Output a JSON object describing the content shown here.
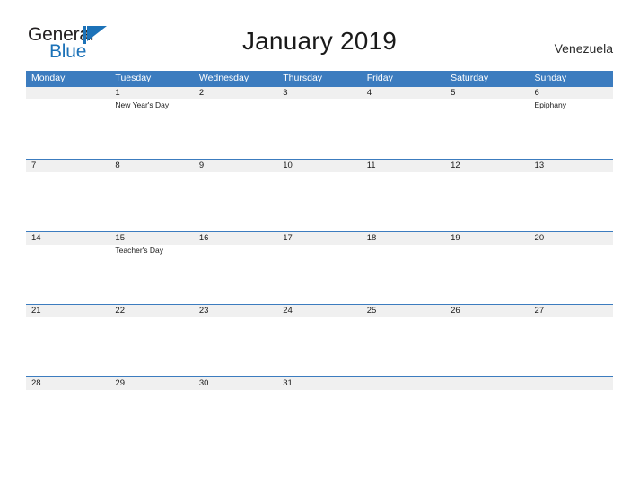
{
  "logo": {
    "word_top": "General",
    "word_bottom": "Blue",
    "flag_icon": "blue-flag-triangle-icon",
    "color_dark": "#231f20",
    "color_blue": "#1c72b8"
  },
  "header": {
    "title": "January 2019",
    "country": "Venezuela"
  },
  "colors": {
    "header_blue": "#3c7cbf",
    "date_band_gray": "#f0f0f0",
    "rule_blue": "#3c7cbf",
    "text_dark": "#1a1a1a"
  },
  "calendar": {
    "weekdays": [
      "Monday",
      "Tuesday",
      "Wednesday",
      "Thursday",
      "Friday",
      "Saturday",
      "Sunday"
    ],
    "weeks": [
      [
        {
          "day": "",
          "events": []
        },
        {
          "day": "1",
          "events": [
            "New Year's Day"
          ]
        },
        {
          "day": "2",
          "events": []
        },
        {
          "day": "3",
          "events": []
        },
        {
          "day": "4",
          "events": []
        },
        {
          "day": "5",
          "events": []
        },
        {
          "day": "6",
          "events": [
            "Epiphany"
          ]
        }
      ],
      [
        {
          "day": "7",
          "events": []
        },
        {
          "day": "8",
          "events": []
        },
        {
          "day": "9",
          "events": []
        },
        {
          "day": "10",
          "events": []
        },
        {
          "day": "11",
          "events": []
        },
        {
          "day": "12",
          "events": []
        },
        {
          "day": "13",
          "events": []
        }
      ],
      [
        {
          "day": "14",
          "events": []
        },
        {
          "day": "15",
          "events": [
            "Teacher's Day"
          ]
        },
        {
          "day": "16",
          "events": []
        },
        {
          "day": "17",
          "events": []
        },
        {
          "day": "18",
          "events": []
        },
        {
          "day": "19",
          "events": []
        },
        {
          "day": "20",
          "events": []
        }
      ],
      [
        {
          "day": "21",
          "events": []
        },
        {
          "day": "22",
          "events": []
        },
        {
          "day": "23",
          "events": []
        },
        {
          "day": "24",
          "events": []
        },
        {
          "day": "25",
          "events": []
        },
        {
          "day": "26",
          "events": []
        },
        {
          "day": "27",
          "events": []
        }
      ],
      [
        {
          "day": "28",
          "events": []
        },
        {
          "day": "29",
          "events": []
        },
        {
          "day": "30",
          "events": []
        },
        {
          "day": "31",
          "events": []
        },
        {
          "day": "",
          "events": []
        },
        {
          "day": "",
          "events": []
        },
        {
          "day": "",
          "events": []
        }
      ]
    ]
  }
}
